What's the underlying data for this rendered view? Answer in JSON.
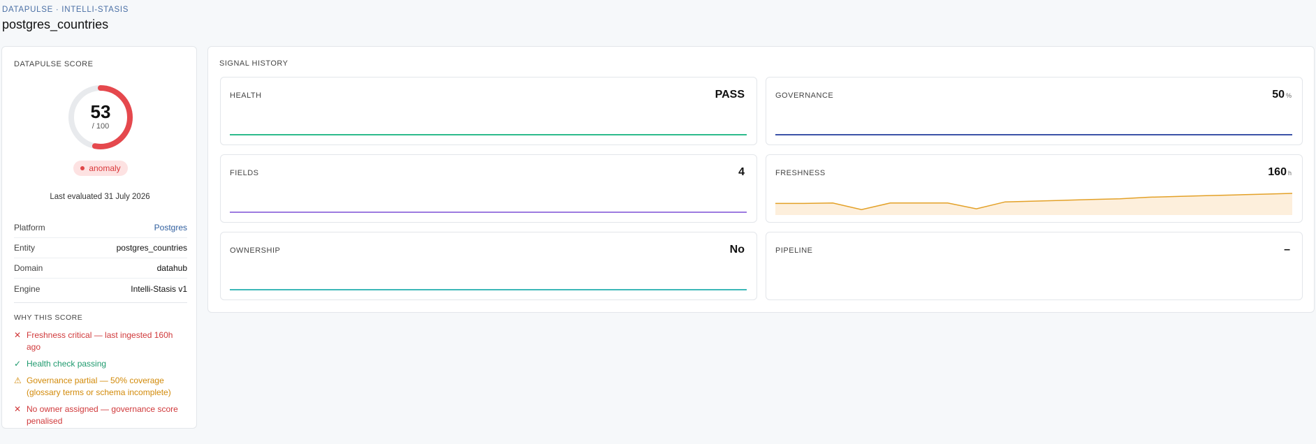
{
  "header": {
    "breadcrumb": "DATAPULSE · INTELLI-STASIS",
    "title": "postgres_countries"
  },
  "score": {
    "label": "DATAPULSE SCORE",
    "value": "53",
    "max": "/ 100",
    "fraction": 0.53,
    "status": "anomaly",
    "last_evaluated": "Last evaluated 31 July 2026"
  },
  "meta": [
    {
      "key": "Platform",
      "value": "Postgres"
    },
    {
      "key": "Entity",
      "value": "postgres_countries"
    },
    {
      "key": "Domain",
      "value": "datahub"
    },
    {
      "key": "Engine",
      "value": "Intelli-Stasis v1"
    }
  ],
  "why": {
    "label": "WHY THIS SCORE",
    "reasons": [
      {
        "kind": "bad",
        "icon": "✕",
        "text": "Freshness critical — last ingested 160h ago"
      },
      {
        "kind": "good",
        "icon": "✓",
        "text": "Health check passing"
      },
      {
        "kind": "warn",
        "icon": "⚠",
        "text": "Governance partial — 50% coverage (glossary terms or schema incomplete)"
      },
      {
        "kind": "bad",
        "icon": "✕",
        "text": "No owner assigned — governance score penalised"
      }
    ]
  },
  "signals": {
    "label": "SIGNAL HISTORY",
    "tiles": [
      {
        "name": "HEALTH",
        "value": "PASS",
        "unit": "",
        "color": "#2dbb8c"
      },
      {
        "name": "GOVERNANCE",
        "value": "50",
        "unit": "%",
        "color": "#3b52a8"
      },
      {
        "name": "FIELDS",
        "value": "4",
        "unit": "",
        "color": "#9d7be0"
      },
      {
        "name": "FRESHNESS",
        "value": "160",
        "unit": "h",
        "color": "#e3a128",
        "fill": "#fdefdc",
        "history": [
          140,
          140,
          141,
          124,
          141,
          141,
          141,
          126,
          144,
          146,
          148,
          150,
          152,
          156,
          158,
          160,
          162,
          164,
          166
        ]
      },
      {
        "name": "OWNERSHIP",
        "value": "No",
        "unit": "",
        "color": "#3cb8b8"
      },
      {
        "name": "PIPELINE",
        "value": "–",
        "unit": "",
        "color": ""
      }
    ]
  },
  "colors": {
    "gauge_track": "#e8eaed",
    "gauge_arc": "#e5484d"
  }
}
